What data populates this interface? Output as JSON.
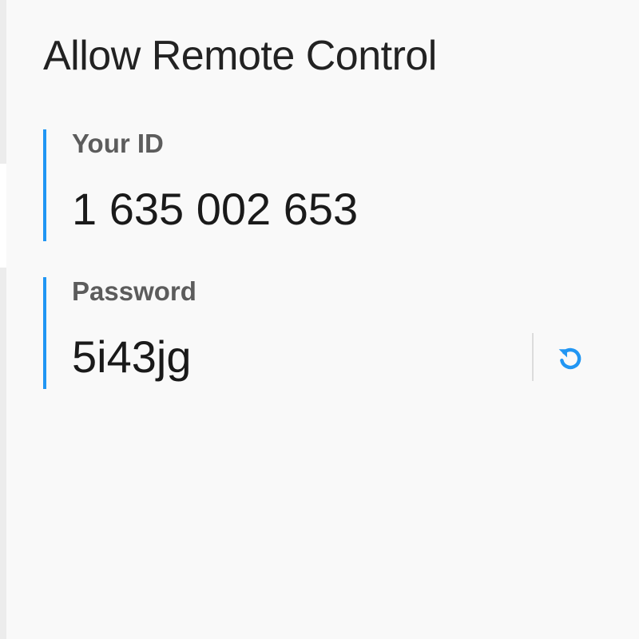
{
  "title": "Allow Remote Control",
  "your_id": {
    "label": "Your ID",
    "value": "1 635 002 653"
  },
  "password": {
    "label": "Password",
    "value": "5i43jg",
    "refresh_icon": "refresh-icon"
  },
  "colors": {
    "accent": "#2196f3",
    "background": "#f9f9f9",
    "label": "#5c5c5c",
    "value": "#1a1a1a"
  }
}
